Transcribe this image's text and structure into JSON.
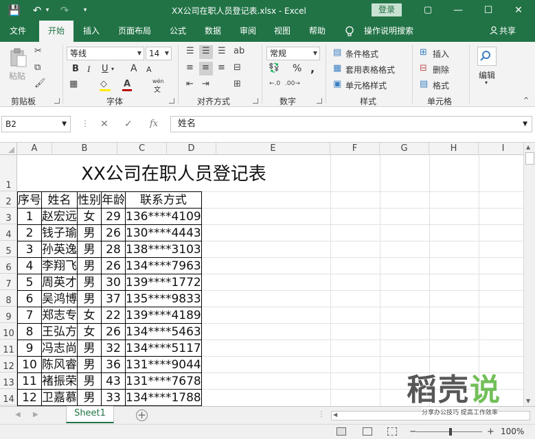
{
  "titlebar": {
    "title": "XX公司在职人员登记表.xlsx  -  Excel",
    "login": "登录",
    "save_glyph": "💾",
    "undo_glyph": "↶",
    "undo_arrow": "▾",
    "redo_glyph": "↷",
    "customize_glyph": "▾",
    "min_glyph": "—",
    "restore_glyph": "▢",
    "max_glyph": "☐",
    "close_glyph": "✕"
  },
  "tabs": [
    {
      "label": "文件"
    },
    {
      "label": "开始"
    },
    {
      "label": "插入"
    },
    {
      "label": "页面布局"
    },
    {
      "label": "公式"
    },
    {
      "label": "数据"
    },
    {
      "label": "审阅"
    },
    {
      "label": "视图"
    },
    {
      "label": "帮助"
    }
  ],
  "tell_me": "操作说明搜索",
  "share": "共享",
  "ribbon": {
    "clipboard": {
      "label": "剪贴板",
      "paste": "粘贴"
    },
    "font": {
      "label": "字体",
      "name": "等线",
      "size": "14",
      "bold": "B",
      "italic": "I",
      "underline": "U",
      "grow": "A",
      "shrink": "A",
      "wen": "wén",
      "wen_char": "文"
    },
    "alignment": {
      "label": "对齐方式"
    },
    "number": {
      "label": "数字",
      "format": "常规",
      "percent": "%",
      "comma": ","
    },
    "styles": {
      "label": "样式",
      "conditional": "条件格式",
      "table": "套用表格格式",
      "cell": "单元格样式"
    },
    "cells": {
      "label": "单元格",
      "insert": "插入",
      "delete": "删除",
      "format": "格式"
    },
    "editing": {
      "label": "编辑"
    }
  },
  "formula_bar": {
    "name_box": "B2",
    "separator": "⋮",
    "cancel": "✕",
    "enter": "✓",
    "fx": "fx",
    "formula": "姓名"
  },
  "columns": [
    "A",
    "B",
    "C",
    "D",
    "E",
    "F",
    "G",
    "H",
    "I"
  ],
  "rows": [
    "1",
    "2",
    "3",
    "4",
    "5",
    "6",
    "7",
    "8",
    "9",
    "10",
    "11",
    "12",
    "13",
    "14"
  ],
  "sheet": {
    "title": "XX公司在职人员登记表",
    "headers": [
      "序号",
      "姓名",
      "性别",
      "年龄",
      "联系方式"
    ],
    "records": [
      [
        "1",
        "赵宏远",
        "女",
        "29",
        "136****4109"
      ],
      [
        "2",
        "钱子瑜",
        "男",
        "26",
        "130****4443"
      ],
      [
        "3",
        "孙英逸",
        "男",
        "28",
        "138****3103"
      ],
      [
        "4",
        "李翔飞",
        "男",
        "26",
        "134****7963"
      ],
      [
        "5",
        "周英才",
        "男",
        "30",
        "139****1772"
      ],
      [
        "6",
        "吴鸿博",
        "男",
        "37",
        "135****9833"
      ],
      [
        "7",
        "郑志专",
        "女",
        "22",
        "139****4189"
      ],
      [
        "8",
        "王弘方",
        "女",
        "26",
        "134****5463"
      ],
      [
        "9",
        "冯志尚",
        "男",
        "32",
        "134****5117"
      ],
      [
        "10",
        "陈风睿",
        "男",
        "36",
        "131****9044"
      ],
      [
        "11",
        "褚振荣",
        "男",
        "43",
        "131****7678"
      ],
      [
        "12",
        "卫嘉慕",
        "男",
        "33",
        "134****1788"
      ]
    ]
  },
  "sheet_tabs": [
    {
      "label": "Sheet1"
    }
  ],
  "add_sheet": "+",
  "status": {
    "zoom": "100%",
    "zoom_out": "−",
    "zoom_in": "+"
  },
  "watermark": {
    "logo": "稻壳说",
    "sub": "分享办公技巧  提高工作效率"
  }
}
